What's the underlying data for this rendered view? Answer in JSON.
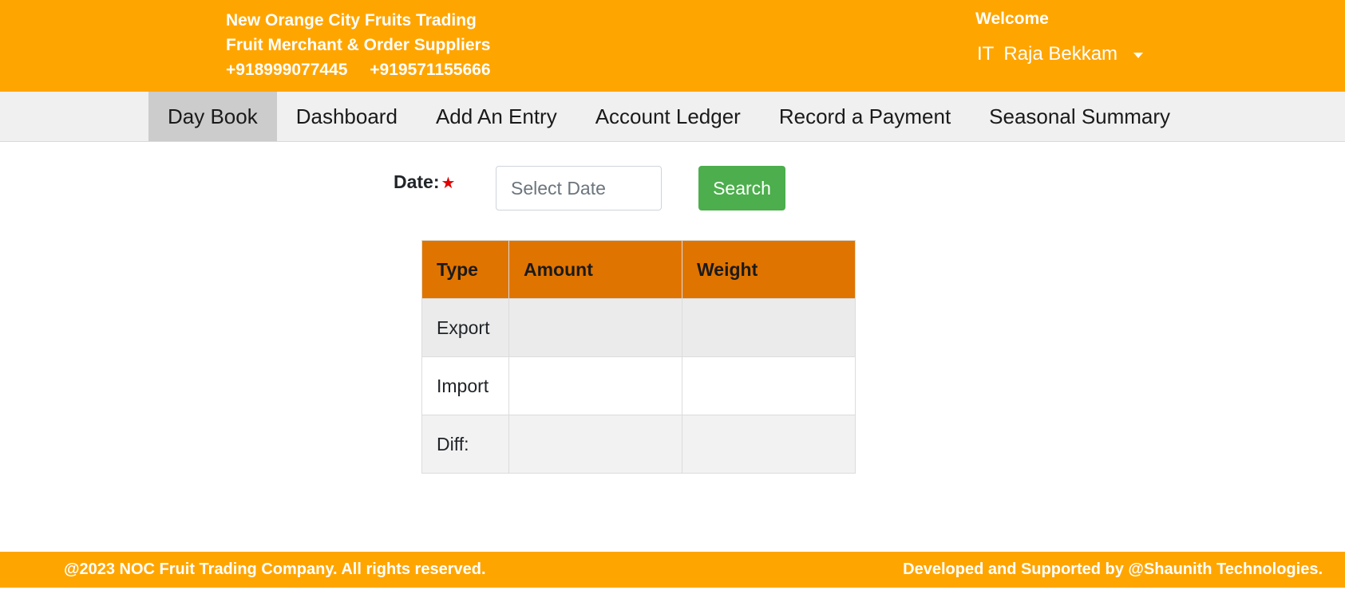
{
  "header": {
    "company_name": "New Orange City Fruits Trading",
    "tagline": "Fruit Merchant & Order Suppliers",
    "phone_1": "+918999077445",
    "phone_2": "+919571155666",
    "welcome": "Welcome",
    "user_prefix": "IT",
    "user_name": "Raja Bekkam"
  },
  "nav": {
    "items": [
      {
        "label": "Day Book",
        "active": true
      },
      {
        "label": "Dashboard"
      },
      {
        "label": "Add An Entry"
      },
      {
        "label": "Account Ledger"
      },
      {
        "label": "Record a Payment"
      },
      {
        "label": "Seasonal Summary"
      }
    ]
  },
  "filter": {
    "date_label": "Date:",
    "required_mark": "★",
    "date_placeholder": "Select Date",
    "search_label": "Search"
  },
  "table": {
    "headers": [
      "Type",
      "Amount",
      "Weight"
    ],
    "rows": [
      [
        "Export",
        "",
        ""
      ],
      [
        "Import",
        "",
        ""
      ],
      [
        "Diff:",
        "",
        ""
      ]
    ]
  },
  "footer": {
    "copyright": "@2023 NOC Fruit Trading Company. All rights reserved.",
    "credit": "Developed and Supported by @Shaunith Technologies."
  },
  "colors": {
    "brand_orange": "#ffa500",
    "table_header": "#e07400",
    "search_button": "#4cae4c",
    "required_star": "#e00000"
  }
}
